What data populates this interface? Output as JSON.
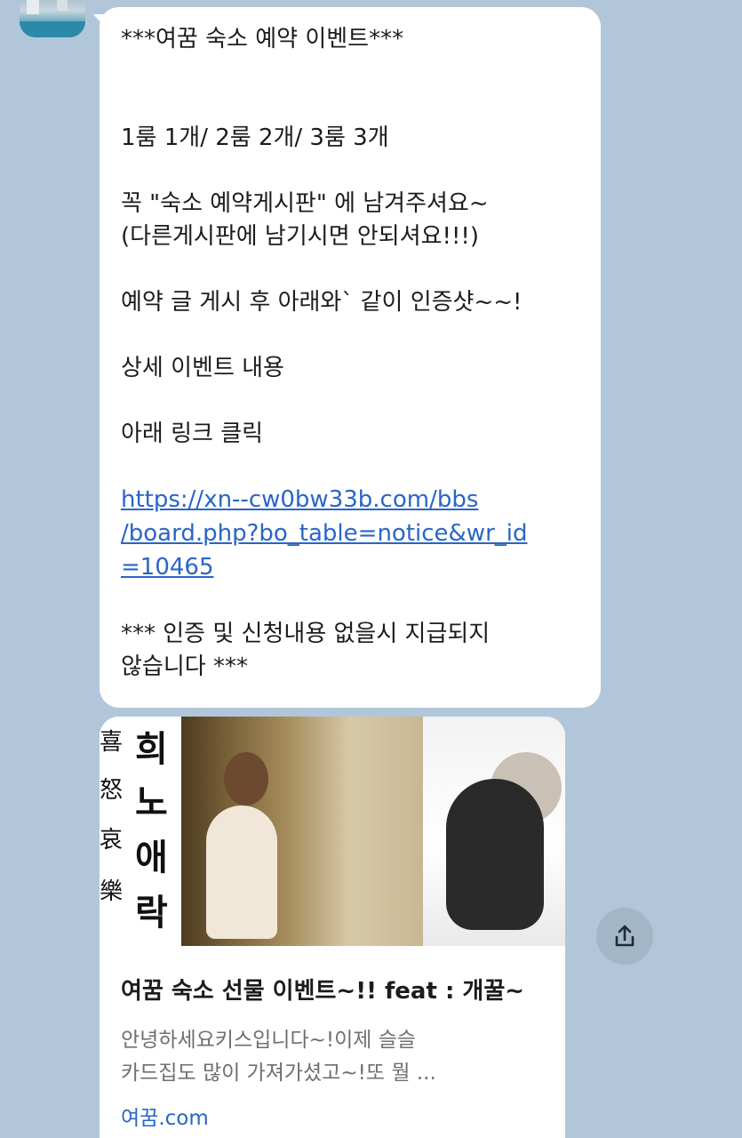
{
  "message": {
    "title": "***여꿈 숙소 예약 이벤트***",
    "rooms": "1룸 1개/ 2룸 2개/ 3룸 3개",
    "instruction_1": "꼭  \"숙소 예약게시판\" 에 남겨주셔요~",
    "instruction_2": "(다른게시판에 남기시면 안되셔요!!!)",
    "instruction_3": "예약 글 게시 후 아래와` 같이 인증샷~~!",
    "details": "상세 이벤트 내용",
    "click_link": "아래 링크 클릭",
    "link_line_1": "https://xn--cw0bw33b.com/bbs",
    "link_line_2": "/board.php?bo_table=notice&wr_id",
    "link_line_3": "=10465",
    "warning_1": "*** 인증 및 신청내용 없을시 지급되지",
    "warning_2": "않습니다 ***"
  },
  "link_preview": {
    "calligraphy": [
      "희",
      "노",
      "애",
      "락"
    ],
    "calligraphy_left": [
      "喜",
      "怒",
      "哀",
      "樂"
    ],
    "title": "여꿈 숙소 선물 이벤트~!! feat : 개꿀~",
    "description_1": "안녕하세요키스입니다~!이제 슬슬",
    "description_2": "카드집도 많이 가져가셨고~!또 뭘 ...",
    "domain": "여꿈.com"
  },
  "icons": {
    "share": "share-icon",
    "avatar": "profile-avatar"
  },
  "colors": {
    "background": "#b2c6d9",
    "bubble": "#ffffff",
    "link": "#2965c8"
  }
}
